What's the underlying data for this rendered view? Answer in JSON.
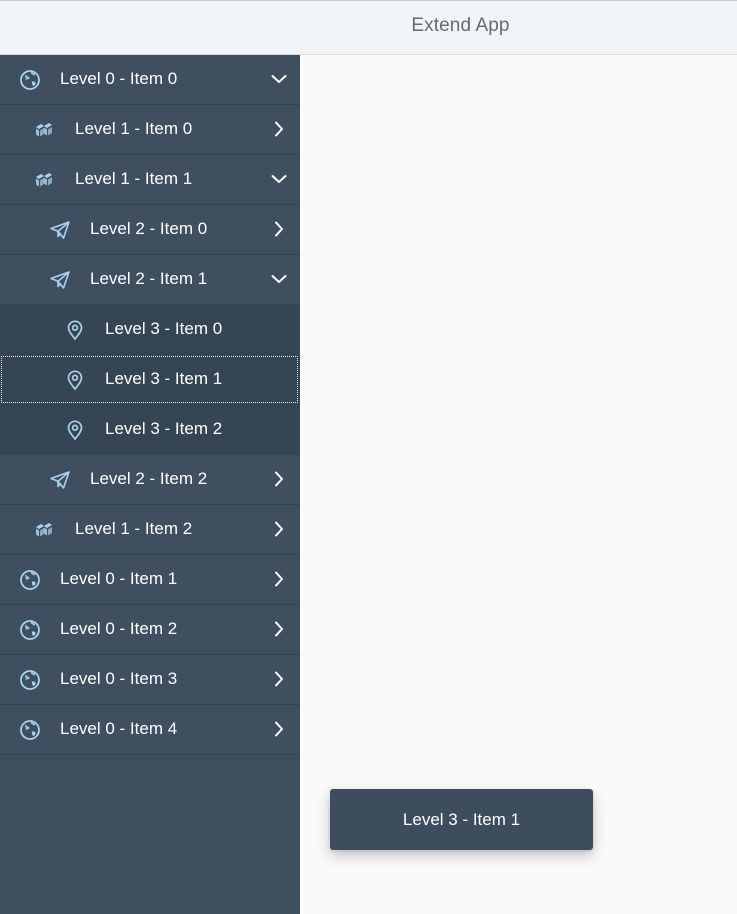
{
  "header": {
    "title": "Extend App"
  },
  "colors": {
    "sidebar_bg": "#3f4f5f",
    "sidebar_level3_bg": "#364554",
    "icon_color": "#a9d2f0",
    "toast_bg": "#3e4d5e"
  },
  "nav": {
    "items": [
      {
        "label": "Level 0 - Item 0",
        "level": 0,
        "icon": "globe-icon",
        "arrow": "chevron-down-icon"
      },
      {
        "label": "Level 1 - Item 0",
        "level": 1,
        "icon": "stacked-blocks-icon",
        "arrow": "chevron-right-icon"
      },
      {
        "label": "Level 1 - Item 1",
        "level": 1,
        "icon": "stacked-blocks-icon",
        "arrow": "chevron-down-icon"
      },
      {
        "label": "Level 2 - Item 0",
        "level": 2,
        "icon": "paper-plane-icon",
        "arrow": "chevron-right-icon"
      },
      {
        "label": "Level 2 - Item 1",
        "level": 2,
        "icon": "paper-plane-icon",
        "arrow": "chevron-down-icon"
      },
      {
        "label": "Level 3 - Item 0",
        "level": 3,
        "icon": "map-pin-icon",
        "arrow": ""
      },
      {
        "label": "Level 3 - Item 1",
        "level": 3,
        "icon": "map-pin-icon",
        "arrow": "",
        "selected": true
      },
      {
        "label": "Level 3 - Item 2",
        "level": 3,
        "icon": "map-pin-icon",
        "arrow": ""
      },
      {
        "label": "Level 2 - Item 2",
        "level": 2,
        "icon": "paper-plane-icon",
        "arrow": "chevron-right-icon"
      },
      {
        "label": "Level 1 - Item 2",
        "level": 1,
        "icon": "stacked-blocks-icon",
        "arrow": "chevron-right-icon"
      },
      {
        "label": "Level 0 - Item 1",
        "level": 0,
        "icon": "globe-icon",
        "arrow": "chevron-right-icon"
      },
      {
        "label": "Level 0 - Item 2",
        "level": 0,
        "icon": "globe-icon",
        "arrow": "chevron-right-icon"
      },
      {
        "label": "Level 0 - Item 3",
        "level": 0,
        "icon": "globe-icon",
        "arrow": "chevron-right-icon"
      },
      {
        "label": "Level 0 - Item 4",
        "level": 0,
        "icon": "globe-icon",
        "arrow": "chevron-right-icon"
      }
    ]
  },
  "toast": {
    "text": "Level 3 - Item 1"
  }
}
